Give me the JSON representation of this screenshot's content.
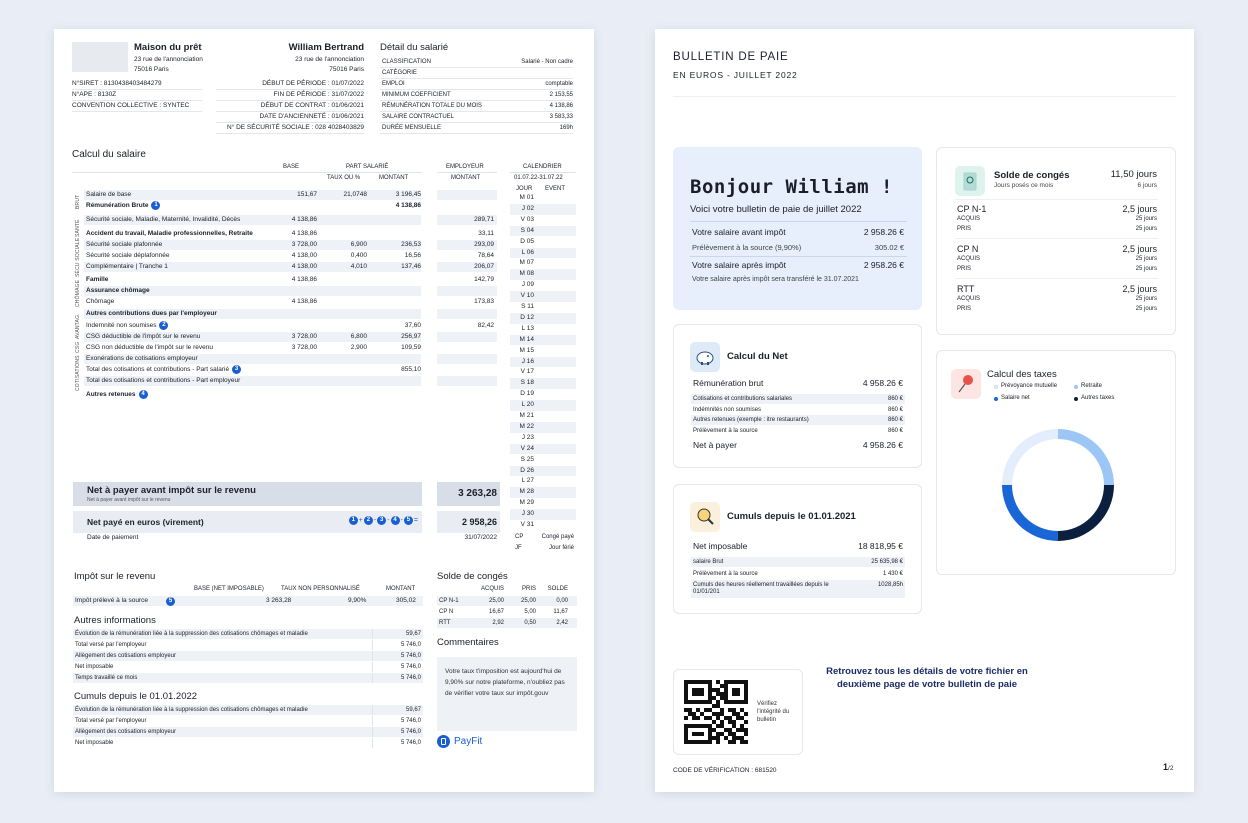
{
  "p1": {
    "employer": {
      "name": "Maison du prêt",
      "addr1": "23 rue de l'annonciation",
      "addr2": "75016 Paris"
    },
    "employee": {
      "name": "William Bertrand",
      "addr1": "23 rue de l'annonciation",
      "addr2": "75016 Paris"
    },
    "ids": [
      "N°SIRET : 8130438403484279",
      "N°APE : 8130Z",
      "CONVENTION COLLECTIVE : SYNTEC"
    ],
    "period": [
      "DÉBUT DE PÉRIODE : 01/07/2022",
      "FIN DE PÉRIODE : 31/07/2022",
      "DÉBUT DE CONTRAT : 01/06/2021",
      "DATE D'ANCIENNETÉ : 01/06/2021",
      "N° DE SÉCURITÉ SOCIALE : 028 4028403829"
    ],
    "detail_title": "Détail du salarié",
    "detail": [
      [
        "CLASSIFICATION",
        "Salarié - Non cadre"
      ],
      [
        "CATÉGORIE",
        ""
      ],
      [
        "EMPLOI",
        "comptable"
      ],
      [
        "MINIMUM COEFFICIENT",
        "2 153,55"
      ],
      [
        "RÉMUNÉRATION TOTALE DU MOIS",
        "4 138,86"
      ],
      [
        "SALAIRE CONTRACTUEL",
        "3 583,33"
      ],
      [
        "DURÉE MENSUELLE",
        "169h"
      ]
    ],
    "calc_title": "Calcul du salaire",
    "hdr": {
      "base": "BASE",
      "part": "PART SALARIÉ",
      "taux": "TAUX OU %",
      "montant": "MONTANT",
      "employeur": "EMPLOYEUR",
      "emontant": "MONTANT",
      "calendrier": "CALENDRIER",
      "dates": "01.07.22-31.07.22",
      "jour": "JOUR",
      "event": "EVENT"
    },
    "side": {
      "brut": "BRUT",
      "sante": "SANTÉ",
      "secu": "SÉCU SOCIALE",
      "chomage": "CHÔMAGE",
      "avantag": "AVANTAG.",
      "csg": "CSG",
      "cotis": "COTISATIONS"
    },
    "rows": [
      {
        "l": "Salaire de base",
        "b": "151,67",
        "t": "21,0748",
        "m": "3 196,45",
        "e": "",
        "bold": false
      },
      {
        "l": "Rémunération Brute",
        "b": "",
        "t": "",
        "m": "4 138,86",
        "e": "",
        "bold": true,
        "badge": "1"
      },
      {
        "l": "Sécurité sociale, Maladie, Maternité, Invalidité, Décès",
        "b": "4 138,86",
        "t": "",
        "m": "",
        "e": "289,71",
        "bold": false
      },
      {
        "l": "Accident du travail, Maladie professionnelles, Retraite",
        "b": "4 138,86",
        "t": "",
        "m": "",
        "e": "33,11",
        "bold": true
      },
      {
        "l": "Sécurité sociale plafonnée",
        "b": "3 728,00",
        "t": "6,900",
        "m": "236,53",
        "e": "293,09",
        "bold": false
      },
      {
        "l": "Sécurité sociale déplafonnée",
        "b": "4 138,00",
        "t": "0,400",
        "m": "16,56",
        "e": "78,64",
        "bold": false
      },
      {
        "l": "Complémentaire | Tranche 1",
        "b": "4 138,00",
        "t": "4,010",
        "m": "137,46",
        "e": "206,07",
        "bold": false
      },
      {
        "l": "Famille",
        "b": "4 138,86",
        "t": "",
        "m": "",
        "e": "142,79",
        "bold": true
      },
      {
        "l": "Assurance chômage",
        "b": "",
        "t": "",
        "m": "",
        "e": "",
        "bold": true
      },
      {
        "l": "Chômage",
        "b": "4 138,86",
        "t": "",
        "m": "",
        "e": "173,83",
        "bold": false
      },
      {
        "l": "Autres contributions dues par l'employeur",
        "b": "",
        "t": "",
        "m": "",
        "e": "",
        "bold": true
      },
      {
        "l": "Indemnité non soumises",
        "b": "",
        "t": "",
        "m": "37,60",
        "e": "82,42",
        "bold": false,
        "badge": "2"
      },
      {
        "l": "CSG déductible de l'impôt sur le revenu",
        "b": "3 728,00",
        "t": "6,800",
        "m": "256,97",
        "e": "",
        "bold": false
      },
      {
        "l": "CSG non déductible de l'impôt sur le revenu",
        "b": "3 728,00",
        "t": "2,900",
        "m": "109,59",
        "e": "",
        "bold": false
      },
      {
        "l": "Exonérations de cotisations employeur",
        "b": "",
        "t": "",
        "m": "",
        "e": "",
        "bold": false
      },
      {
        "l": "Total des cotisations et contributions - Part salarié",
        "b": "",
        "t": "",
        "m": "855,10",
        "e": "",
        "bold": false,
        "badge": "3"
      },
      {
        "l": "Total des cotisations et contributions - Part employeur",
        "b": "",
        "t": "",
        "m": "",
        "e": "",
        "bold": false
      },
      {
        "l": "Autres retenues",
        "b": "",
        "t": "",
        "m": "",
        "e": "",
        "bold": true,
        "badge": "4"
      }
    ],
    "calendar": [
      "M 01",
      "J 02",
      "V 03",
      "S 04",
      "D 05",
      "L 06",
      "M 07",
      "M 08",
      "J 09",
      "V 10",
      "S 11",
      "D 12",
      "L 13",
      "M 14",
      "M 15",
      "J 16",
      "V 17",
      "S 18",
      "D 19",
      "L 20",
      "M 21",
      "M 22",
      "J 23",
      "V 24",
      "S 25",
      "D 26",
      "L 27",
      "M 28",
      "M 29",
      "J 30",
      "V 31"
    ],
    "legend": [
      [
        "CP",
        "Congé payé"
      ],
      [
        "JF",
        "Jour férié"
      ]
    ],
    "net_avant": {
      "label": "Net à payer avant impôt sur le revenu",
      "sub": "Net à payer avant impôt sur le revenu",
      "value": "3 263,28"
    },
    "net_paye": {
      "label": "Net payé en euros (virement)",
      "formula": [
        "1",
        "+",
        "2",
        "-",
        "3",
        "-",
        "4",
        "-",
        "5",
        "="
      ],
      "value": "2 958,26"
    },
    "date_paiement": {
      "label": "Date de paiement",
      "value": "31/07/2022"
    },
    "impot": {
      "title": "Impôt sur le revenu",
      "h": [
        "BASE (NET IMPOSABLE)",
        "TAUX NON PERSONNALISÉ",
        "MONTANT"
      ],
      "row": [
        "Impôt prélevé à la source",
        "3 263,28",
        "9,90%",
        "305,02"
      ],
      "badge": "5"
    },
    "autres": {
      "title": "Autres informations",
      "rows": [
        [
          "Évolution de la rémunération liée à la suppression des cotisations chômages et maladie",
          "59,67"
        ],
        [
          "Total versé par l'employeur",
          "5 746,0"
        ],
        [
          "Allègement des cotisations employeur",
          "5 746,0"
        ],
        [
          "Net imposable",
          "5 746,0"
        ],
        [
          "Temps travaillé ce mois",
          "5 746,0"
        ]
      ]
    },
    "cumuls": {
      "title": "Cumuls depuis le 01.01.2022",
      "rows": [
        [
          "Évolution de la rémunération liée à la suppression des cotisations chômages et maladie",
          "59,67"
        ],
        [
          "Total versé par l'employeur",
          "5 746,0"
        ],
        [
          "Allègement des cotisations employeur",
          "5 746,0"
        ],
        [
          "Net imposable",
          "5 746,0"
        ]
      ]
    },
    "conges": {
      "title": "Solde de congés",
      "h": [
        "ACQUIS",
        "PRIS",
        "SOLDE"
      ],
      "rows": [
        [
          "CP N-1",
          "25,00",
          "25,00",
          "0,00"
        ],
        [
          "CP N",
          "16,67",
          "5,00",
          "11,67"
        ],
        [
          "RTT",
          "2,92",
          "0,50",
          "2,42"
        ]
      ]
    },
    "comm": {
      "title": "Commentaires",
      "text": "Votre taux t'imposition est aujourd'hui de 9,90% sur notre plateforme, n'oubliez pas de vérifier votre taux sur impôt.gouv"
    },
    "brand": "PayFit"
  },
  "p2": {
    "title": "BULLETIN DE PAIE",
    "subtitle": "EN EUROS - JUILLET 2022",
    "hello": {
      "title": "Bonjour William !",
      "sub": "Voici votre bulletin de paie de juillet 2022",
      "r1": [
        "Votre salaire avant impôt",
        "2 958.26 €"
      ],
      "r2": [
        "Prélèvement à la source (9,90%)",
        "305.02 €"
      ],
      "r3": [
        "Votre salaire après impôt",
        "2 958.26 €"
      ],
      "note": "Votre salaire après impôt sera transféré le 31.07.2021"
    },
    "net": {
      "title": "Calcul du Net",
      "brut": [
        "Rémunération brut",
        "4 958.26 €"
      ],
      "rows": [
        [
          "Cotisations et contributions salariales",
          "860 €"
        ],
        [
          "Indémnités non soumises",
          "860 €"
        ],
        [
          "Autres retenues (exemple : itre restaurants)",
          "860 €"
        ],
        [
          "Prélèvement à la source",
          "860 €"
        ]
      ],
      "total": [
        "Net à payer",
        "4 958.26 €"
      ]
    },
    "cumuls": {
      "title": "Cumuls depuis le 01.01.2021",
      "main": [
        "Net imposable",
        "18 818,95 €"
      ],
      "rows": [
        [
          "salaire Brut",
          "25 635,98 €"
        ],
        [
          "Prélèvement à la source",
          "1 430 €"
        ],
        [
          "Cumuls des heures réellement travaillées depuis le 01/01/201",
          "1028,85h"
        ]
      ]
    },
    "conges": {
      "title": "Solde de congés",
      "sub": "Jours posés ce mois",
      "total": "11,50 jours",
      "posed": "6 jours",
      "groups": [
        {
          "name": "CP N-1",
          "val": "2,5 jours",
          "acq": "25 jours",
          "pris": "25 jours"
        },
        {
          "name": "CP N",
          "val": "2,5 jours",
          "acq": "25 jours",
          "pris": "25 jours"
        },
        {
          "name": "RTT",
          "val": "2,5 jours",
          "acq": "25 jours",
          "pris": "25 jours"
        }
      ],
      "acquis": "ACQUIS",
      "pris": "PRIS"
    },
    "taxes": {
      "title": "Calcul des taxes",
      "legend": [
        {
          "label": "Prévoyance mutuelle",
          "color": "#e3edfb"
        },
        {
          "label": "Retraite",
          "color": "#9cc6f5"
        },
        {
          "label": "Salaire net",
          "color": "#1a66d6"
        },
        {
          "label": "Autres taxes",
          "color": "#0b1f3f"
        }
      ]
    },
    "qr": {
      "text": "Vérifiez l'intégrité du bulletin"
    },
    "info": "Retrouvez tous les détails de votre fichier en deuxième page de votre bulletin de paie",
    "code": "CODE DE VÉRIFICATION : 681520",
    "page": "1",
    "pages": "/2"
  },
  "chart_data": {
    "type": "pie",
    "series": [
      {
        "values": [
          25,
          25,
          25,
          25
        ]
      }
    ]
  }
}
